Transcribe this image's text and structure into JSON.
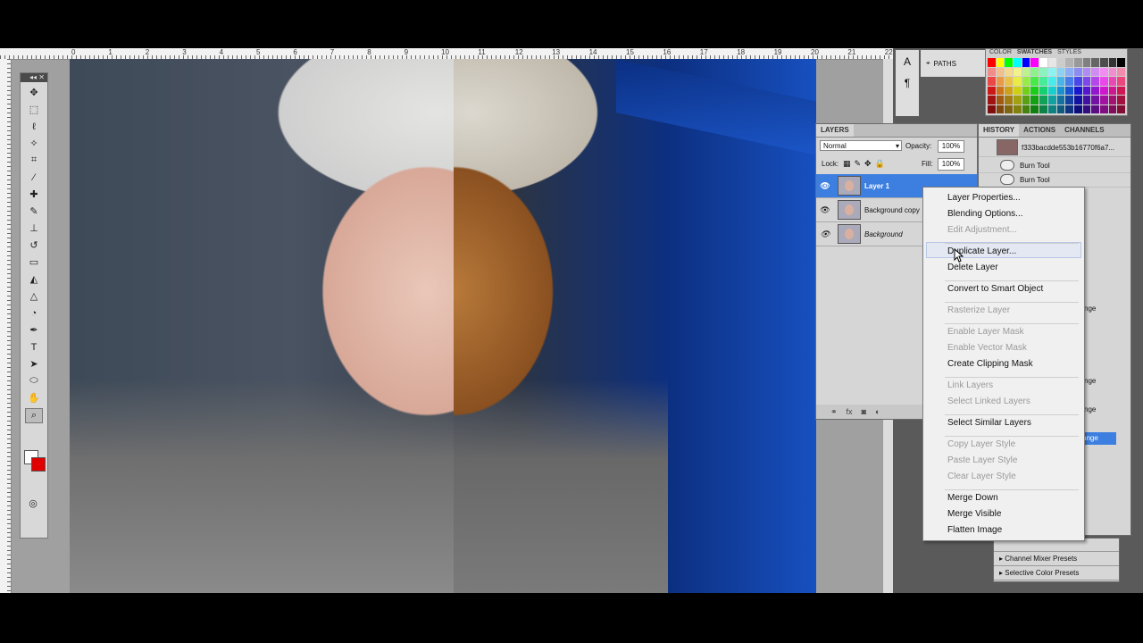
{
  "rulers": {
    "top_ticks": [
      "0",
      "1",
      "2",
      "3",
      "4",
      "5",
      "6",
      "7",
      "8",
      "9",
      "10",
      "11",
      "12",
      "13",
      "14",
      "15",
      "16",
      "17",
      "18",
      "19",
      "20",
      "21",
      "22"
    ]
  },
  "panels": {
    "paths_label": "PATHS",
    "swatch_tabs": [
      "COLOR",
      "SWATCHES",
      "STYLES"
    ],
    "layers": {
      "tab": "LAYERS",
      "blend_mode": "Normal",
      "opacity_label": "Opacity:",
      "opacity_value": "100%",
      "lock_label": "Lock:",
      "fill_label": "Fill:",
      "fill_value": "100%",
      "items": [
        {
          "name": "Layer 1",
          "selected": true
        },
        {
          "name": "Background copy",
          "selected": false
        },
        {
          "name": "Background",
          "selected": false
        }
      ]
    },
    "history": {
      "tabs": [
        "HISTORY",
        "ACTIONS",
        "CHANNELS"
      ],
      "snapshot": "f333bacdde553b16770f6a7...",
      "items": [
        "Burn Tool",
        "Burn Tool"
      ],
      "clipped": [
        "nge",
        "nge",
        "nge",
        "ange"
      ]
    },
    "adjustments": {
      "items": [
        "Channel Mixer Presets",
        "Selective Color Presets"
      ]
    }
  },
  "context_menu": {
    "groups": [
      [
        {
          "label": "Layer Properties...",
          "enabled": true
        },
        {
          "label": "Blending Options...",
          "enabled": true
        },
        {
          "label": "Edit Adjustment...",
          "enabled": false
        }
      ],
      [
        {
          "label": "Duplicate Layer...",
          "enabled": true
        },
        {
          "label": "Delete Layer",
          "enabled": true
        }
      ],
      [
        {
          "label": "Convert to Smart Object",
          "enabled": true
        }
      ],
      [
        {
          "label": "Rasterize Layer",
          "enabled": false
        }
      ],
      [
        {
          "label": "Enable Layer Mask",
          "enabled": false
        },
        {
          "label": "Enable Vector Mask",
          "enabled": false
        },
        {
          "label": "Create Clipping Mask",
          "enabled": true
        }
      ],
      [
        {
          "label": "Link Layers",
          "enabled": false
        },
        {
          "label": "Select Linked Layers",
          "enabled": false
        }
      ],
      [
        {
          "label": "Select Similar Layers",
          "enabled": true
        }
      ],
      [
        {
          "label": "Copy Layer Style",
          "enabled": false
        },
        {
          "label": "Paste Layer Style",
          "enabled": false
        },
        {
          "label": "Clear Layer Style",
          "enabled": false
        }
      ],
      [
        {
          "label": "Merge Down",
          "enabled": true
        },
        {
          "label": "Merge Visible",
          "enabled": true
        },
        {
          "label": "Flatten Image",
          "enabled": true
        }
      ]
    ],
    "hovered": "Duplicate Layer..."
  },
  "colors": {
    "foreground": "#ffffff",
    "background": "#e00000",
    "layer_selection": "#3d7fe0"
  }
}
